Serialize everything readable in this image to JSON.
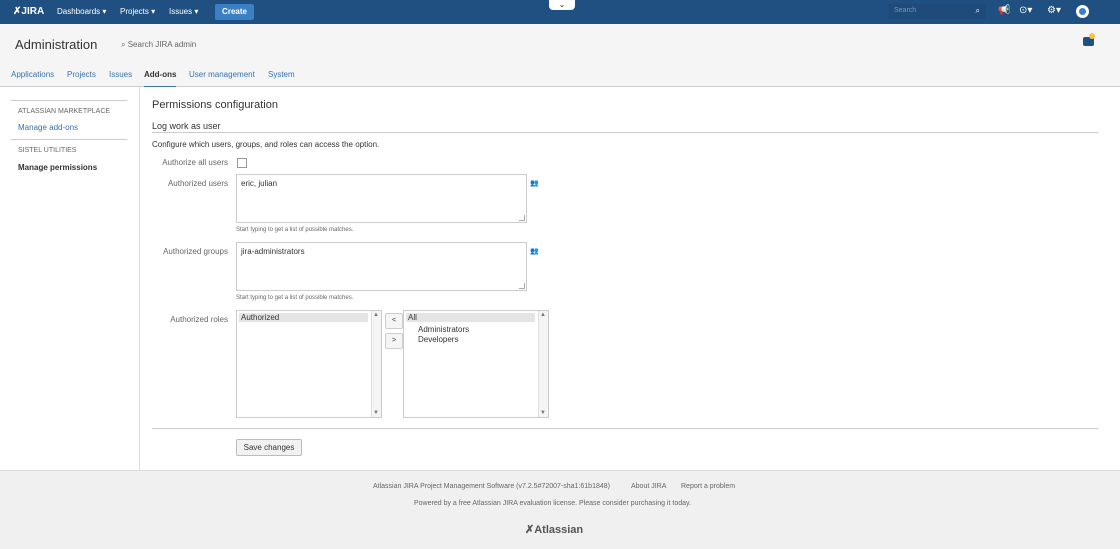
{
  "topbar": {
    "logo": "JIRA",
    "nav": [
      "Dashboards ▾",
      "Projects ▾",
      "Issues ▾"
    ],
    "create_label": "Create",
    "search_placeholder": "Search",
    "icons": [
      "megaphone-icon",
      "help-icon",
      "gear-icon",
      "user-avatar"
    ]
  },
  "header": {
    "title": "Administration",
    "search_label": "Search JIRA admin"
  },
  "tabs": [
    {
      "label": "Applications",
      "active": false
    },
    {
      "label": "Projects",
      "active": false
    },
    {
      "label": "Issues",
      "active": false
    },
    {
      "label": "Add-ons",
      "active": true
    },
    {
      "label": "User management",
      "active": false
    },
    {
      "label": "System",
      "active": false
    }
  ],
  "sidebar": {
    "sections": [
      {
        "heading": "ATLASSIAN MARKETPLACE",
        "items": [
          {
            "label": "Manage add-ons",
            "current": false
          }
        ]
      },
      {
        "heading": "SISTEL UTILITIES",
        "items": [
          {
            "label": "Manage permissions",
            "current": true
          }
        ]
      }
    ]
  },
  "main": {
    "title": "Permissions configuration",
    "subtitle": "Log work as user",
    "description": "Configure which users, groups, and roles can access the option.",
    "authorize_all": {
      "label": "Authorize all users",
      "checked": false
    },
    "users": {
      "label": "Authorized users",
      "value": "eric, julian",
      "hint": "Start typing to get a list of possible matches."
    },
    "groups": {
      "label": "Authorized groups",
      "value": "jira-administrators",
      "hint": "Start typing to get a list of possible matches."
    },
    "roles": {
      "label": "Authorized roles",
      "authorized": [
        "Authorized"
      ],
      "available_header": "All",
      "available": [
        "Administrators",
        "Developers"
      ],
      "move_left": "<",
      "move_right": ">"
    },
    "save_label": "Save changes"
  },
  "footer": {
    "version": "Atlassian JIRA Project Management Software (v7.2.5#72007-sha1:61b1848)",
    "about": "About JIRA",
    "report": "Report a problem",
    "license": "Powered by a free Atlassian JIRA evaluation license. Please consider purchasing it today.",
    "brand": "Atlassian"
  },
  "colors": {
    "topbar": "#205081",
    "link": "#3572b0",
    "create": "#3b7fc4"
  }
}
